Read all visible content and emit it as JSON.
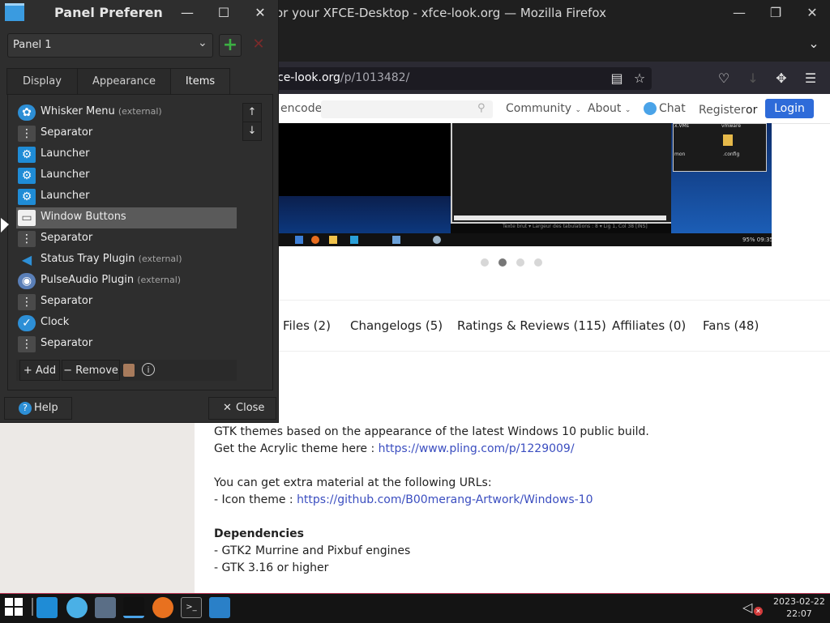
{
  "firefox": {
    "title": "or your XFCE-Desktop - xfce-look.org — Mozilla Firefox",
    "url_host": "ce-look.org",
    "url_path": "/p/1013482/",
    "nav": {
      "search_partial": "encode.n",
      "community": "Community",
      "about": "About",
      "chat": "Chat",
      "register": "Register",
      "or": "or",
      "login": "Login"
    },
    "preview": {
      "labels": [
        "x.VMs",
        "vmware",
        "mon",
        ".config"
      ],
      "statusbar_text": "Texte brut  ▾  Largeur des tabulations : 8  ▾  Lig 1, Col 38  [INS]",
      "tray_time": "95% 09:35"
    },
    "tabs": [
      "Files (2)",
      "Changelogs (5)",
      "Ratings & Reviews (115)",
      "Affiliates (0)",
      "Fans (48)"
    ],
    "description": {
      "line1": "GTK themes based on the appearance of the latest Windows 10 public build.",
      "line2_prefix": "Get the Acrylic theme here : ",
      "line2_link": "https://www.pling.com/p/1229009/",
      "line3": "You can get extra material at the following URLs:",
      "line4_prefix": "- Icon theme : ",
      "line4_link": "https://github.com/B00merang-Artwork/Windows-10",
      "deps_heading": "Dependencies",
      "dep1": "- GTK2 Murrine and Pixbuf engines",
      "dep2": "- GTK 3.16 or higher"
    }
  },
  "dialog": {
    "title": "Panel Preferen",
    "panel_select_value": "Panel 1",
    "tabs": [
      "Display",
      "Appearance",
      "Items"
    ],
    "items": [
      {
        "label": "Whisker Menu",
        "ext": "(external)"
      },
      {
        "label": "Separator",
        "ext": ""
      },
      {
        "label": "Launcher",
        "ext": ""
      },
      {
        "label": "Launcher",
        "ext": ""
      },
      {
        "label": "Launcher",
        "ext": ""
      },
      {
        "label": "Window Buttons",
        "ext": ""
      },
      {
        "label": "Separator",
        "ext": ""
      },
      {
        "label": "Status Tray Plugin",
        "ext": "(external)"
      },
      {
        "label": "PulseAudio Plugin",
        "ext": "(external)"
      },
      {
        "label": "Separator",
        "ext": ""
      },
      {
        "label": "Clock",
        "ext": ""
      },
      {
        "label": "Separator",
        "ext": ""
      }
    ],
    "add_label": "Add",
    "remove_label": "Remove",
    "help_label": "Help",
    "close_label": "Close"
  },
  "taskbar": {
    "date": "2023-02-22",
    "time": "22:07"
  },
  "colors": {
    "accent_blue": "#2e6bd9",
    "link": "#3b4ec0",
    "add_green": "#3cb043",
    "remove_red": "#c0392b",
    "taskbar_border": "#c43a5a"
  }
}
